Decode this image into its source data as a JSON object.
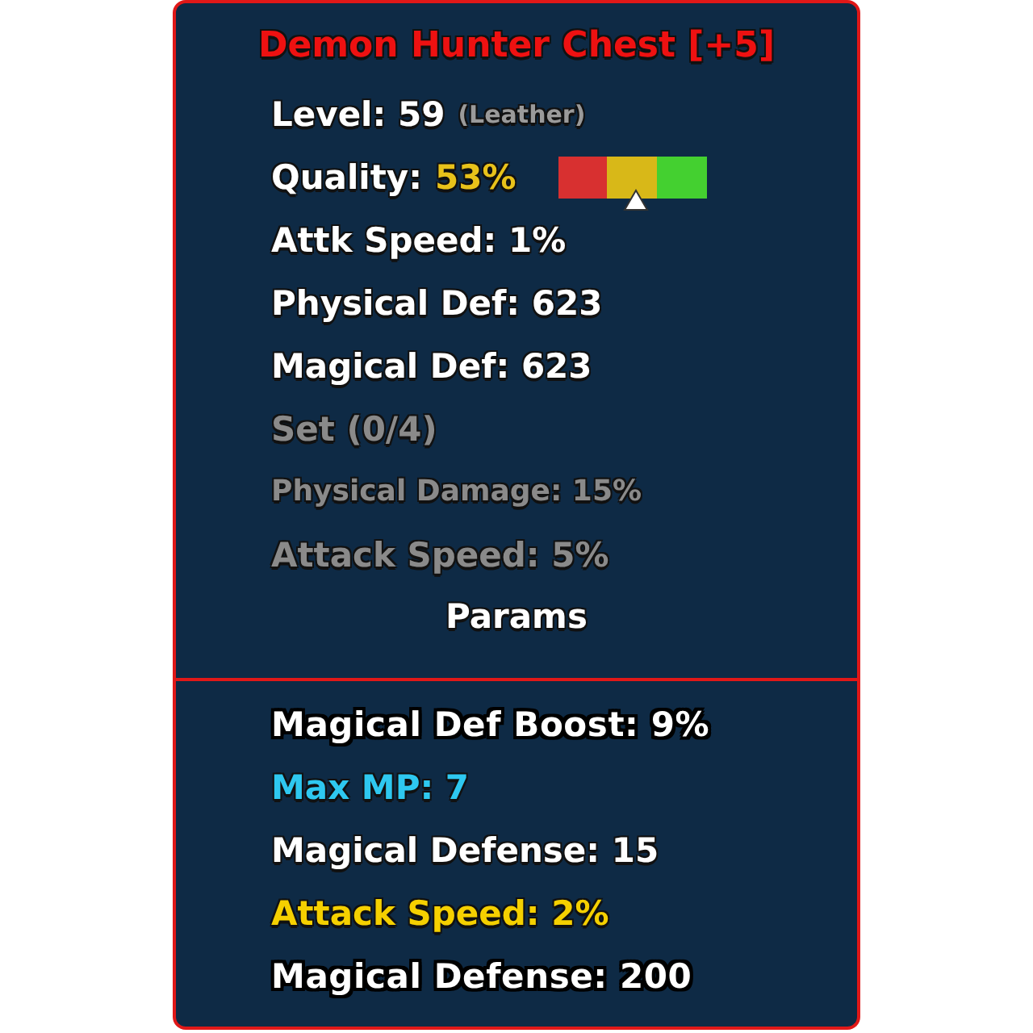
{
  "title": "Demon Hunter Chest [+5]",
  "level": {
    "label": "Level: 59",
    "material": "(Leather)"
  },
  "quality": {
    "label": "Quality:",
    "value": "53%"
  },
  "stats": [
    "Attk Speed: 1%",
    "Physical Def: 623",
    "Magical Def: 623"
  ],
  "set": {
    "title": "Set (0/4)",
    "active": false,
    "bonuses": [
      "Physical Damage: 15%",
      "Attack Speed: 5%"
    ]
  },
  "params_heading": "Params",
  "params": [
    {
      "text": "Magical Def Boost: 9%",
      "kind": "outlined",
      "color": "#ffffff"
    },
    {
      "text": "Max MP: 7",
      "kind": "plain",
      "color": "#2ec8f0"
    },
    {
      "text": "Magical Defense: 15",
      "kind": "plain",
      "color": "#ffffff"
    },
    {
      "text": "Attack Speed: 2%",
      "kind": "plain",
      "color": "#f5d000"
    },
    {
      "text": "Magical Defense: 200",
      "kind": "outlined",
      "color": "#ffffff"
    }
  ]
}
